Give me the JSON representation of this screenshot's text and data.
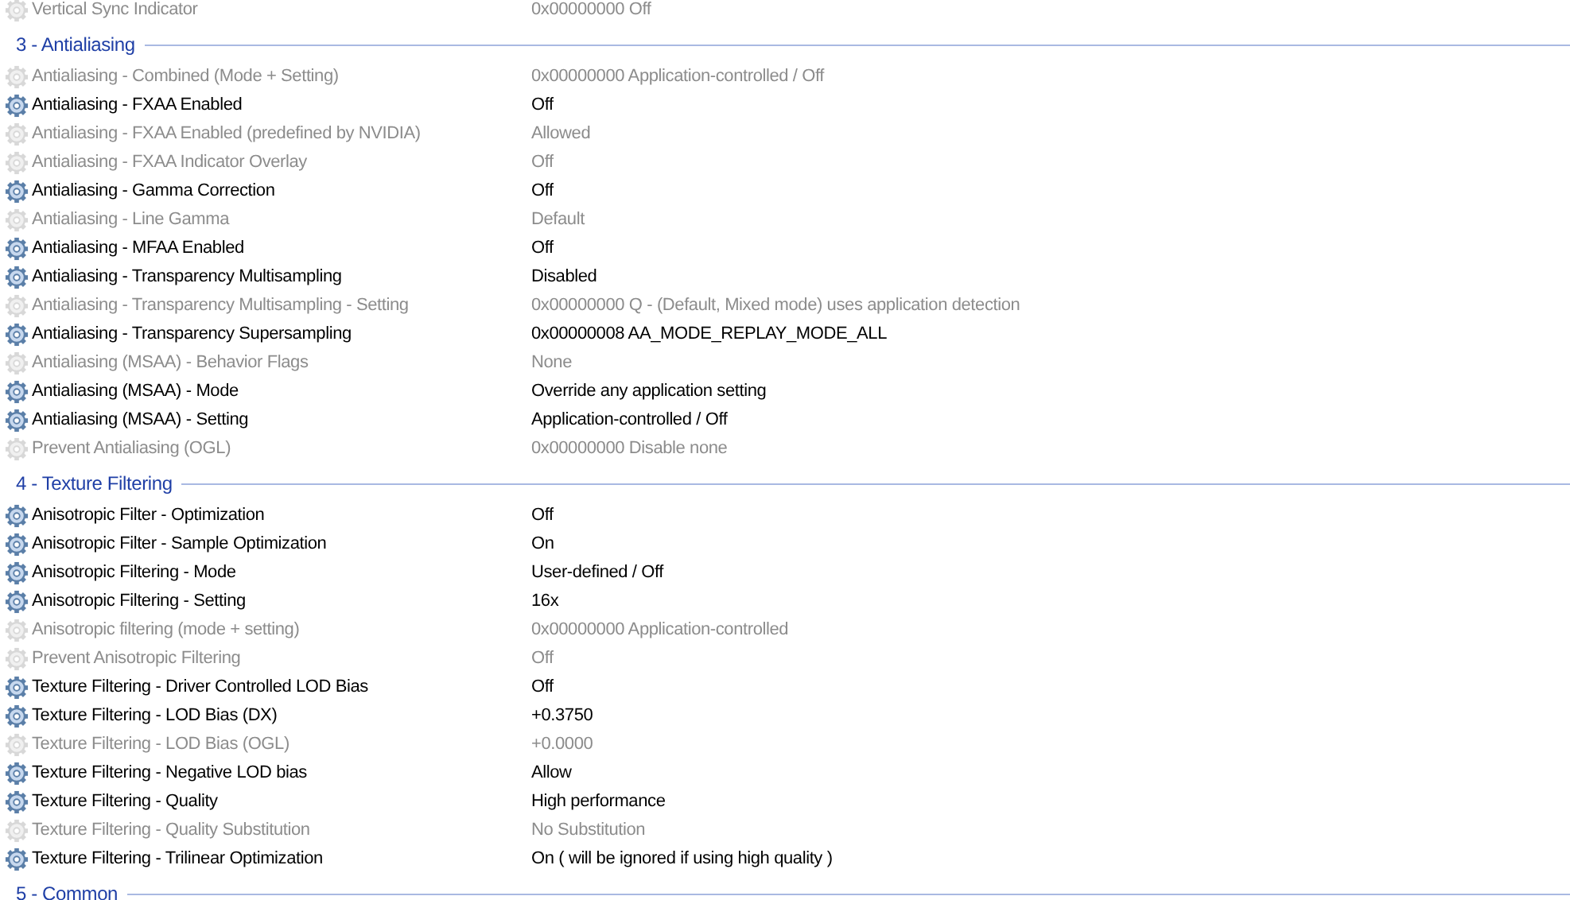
{
  "groups": [
    {
      "items": [
        {
          "name": "Vertical Sync Indicator",
          "value": "0x00000000 Off",
          "user_defined": false
        }
      ]
    },
    {
      "title": "3 - Antialiasing",
      "items": [
        {
          "name": "Antialiasing - Combined (Mode + Setting)",
          "value": "0x00000000 Application-controlled / Off",
          "user_defined": false
        },
        {
          "name": "Antialiasing - FXAA Enabled",
          "value": "Off",
          "user_defined": true
        },
        {
          "name": "Antialiasing - FXAA Enabled (predefined by NVIDIA)",
          "value": "Allowed",
          "user_defined": false
        },
        {
          "name": "Antialiasing - FXAA Indicator Overlay",
          "value": "Off",
          "user_defined": false
        },
        {
          "name": "Antialiasing - Gamma Correction",
          "value": "Off",
          "user_defined": true
        },
        {
          "name": "Antialiasing - Line Gamma",
          "value": "Default",
          "user_defined": false
        },
        {
          "name": "Antialiasing - MFAA Enabled",
          "value": "Off",
          "user_defined": true
        },
        {
          "name": "Antialiasing - Transparency Multisampling",
          "value": "Disabled",
          "user_defined": true
        },
        {
          "name": "Antialiasing - Transparency Multisampling - Setting",
          "value": "0x00000000 Q - (Default, Mixed mode) uses application detection",
          "user_defined": false
        },
        {
          "name": "Antialiasing - Transparency Supersampling",
          "value": "0x00000008 AA_MODE_REPLAY_MODE_ALL",
          "user_defined": true
        },
        {
          "name": "Antialiasing (MSAA) - Behavior Flags",
          "value": "None",
          "user_defined": false
        },
        {
          "name": "Antialiasing (MSAA) - Mode",
          "value": "Override any application setting",
          "user_defined": true
        },
        {
          "name": "Antialiasing (MSAA) - Setting",
          "value": "Application-controlled / Off",
          "user_defined": true
        },
        {
          "name": "Prevent Antialiasing (OGL)",
          "value": "0x00000000 Disable none",
          "user_defined": false
        }
      ]
    },
    {
      "title": "4 - Texture Filtering",
      "items": [
        {
          "name": "Anisotropic Filter - Optimization",
          "value": "Off",
          "user_defined": true
        },
        {
          "name": "Anisotropic Filter - Sample Optimization",
          "value": "On",
          "user_defined": true
        },
        {
          "name": "Anisotropic Filtering - Mode",
          "value": "User-defined / Off",
          "user_defined": true
        },
        {
          "name": "Anisotropic Filtering - Setting",
          "value": "16x",
          "user_defined": true
        },
        {
          "name": "Anisotropic filtering (mode + setting)",
          "value": "0x00000000 Application-controlled",
          "user_defined": false
        },
        {
          "name": "Prevent Anisotropic Filtering",
          "value": "Off",
          "user_defined": false
        },
        {
          "name": "Texture Filtering - Driver Controlled LOD Bias",
          "value": "Off",
          "user_defined": true
        },
        {
          "name": "Texture Filtering - LOD Bias (DX)",
          "value": "+0.3750",
          "user_defined": true
        },
        {
          "name": "Texture Filtering - LOD Bias (OGL)",
          "value": "+0.0000",
          "user_defined": false
        },
        {
          "name": "Texture Filtering - Negative LOD bias",
          "value": "Allow",
          "user_defined": true
        },
        {
          "name": "Texture Filtering - Quality",
          "value": "High performance",
          "user_defined": true
        },
        {
          "name": "Texture Filtering - Quality Substitution",
          "value": "No Substitution",
          "user_defined": false
        },
        {
          "name": "Texture Filtering - Trilinear Optimization",
          "value": "On ( will be ignored if using high quality )",
          "user_defined": true
        }
      ]
    },
    {
      "title": "5 - Common"
    }
  ]
}
